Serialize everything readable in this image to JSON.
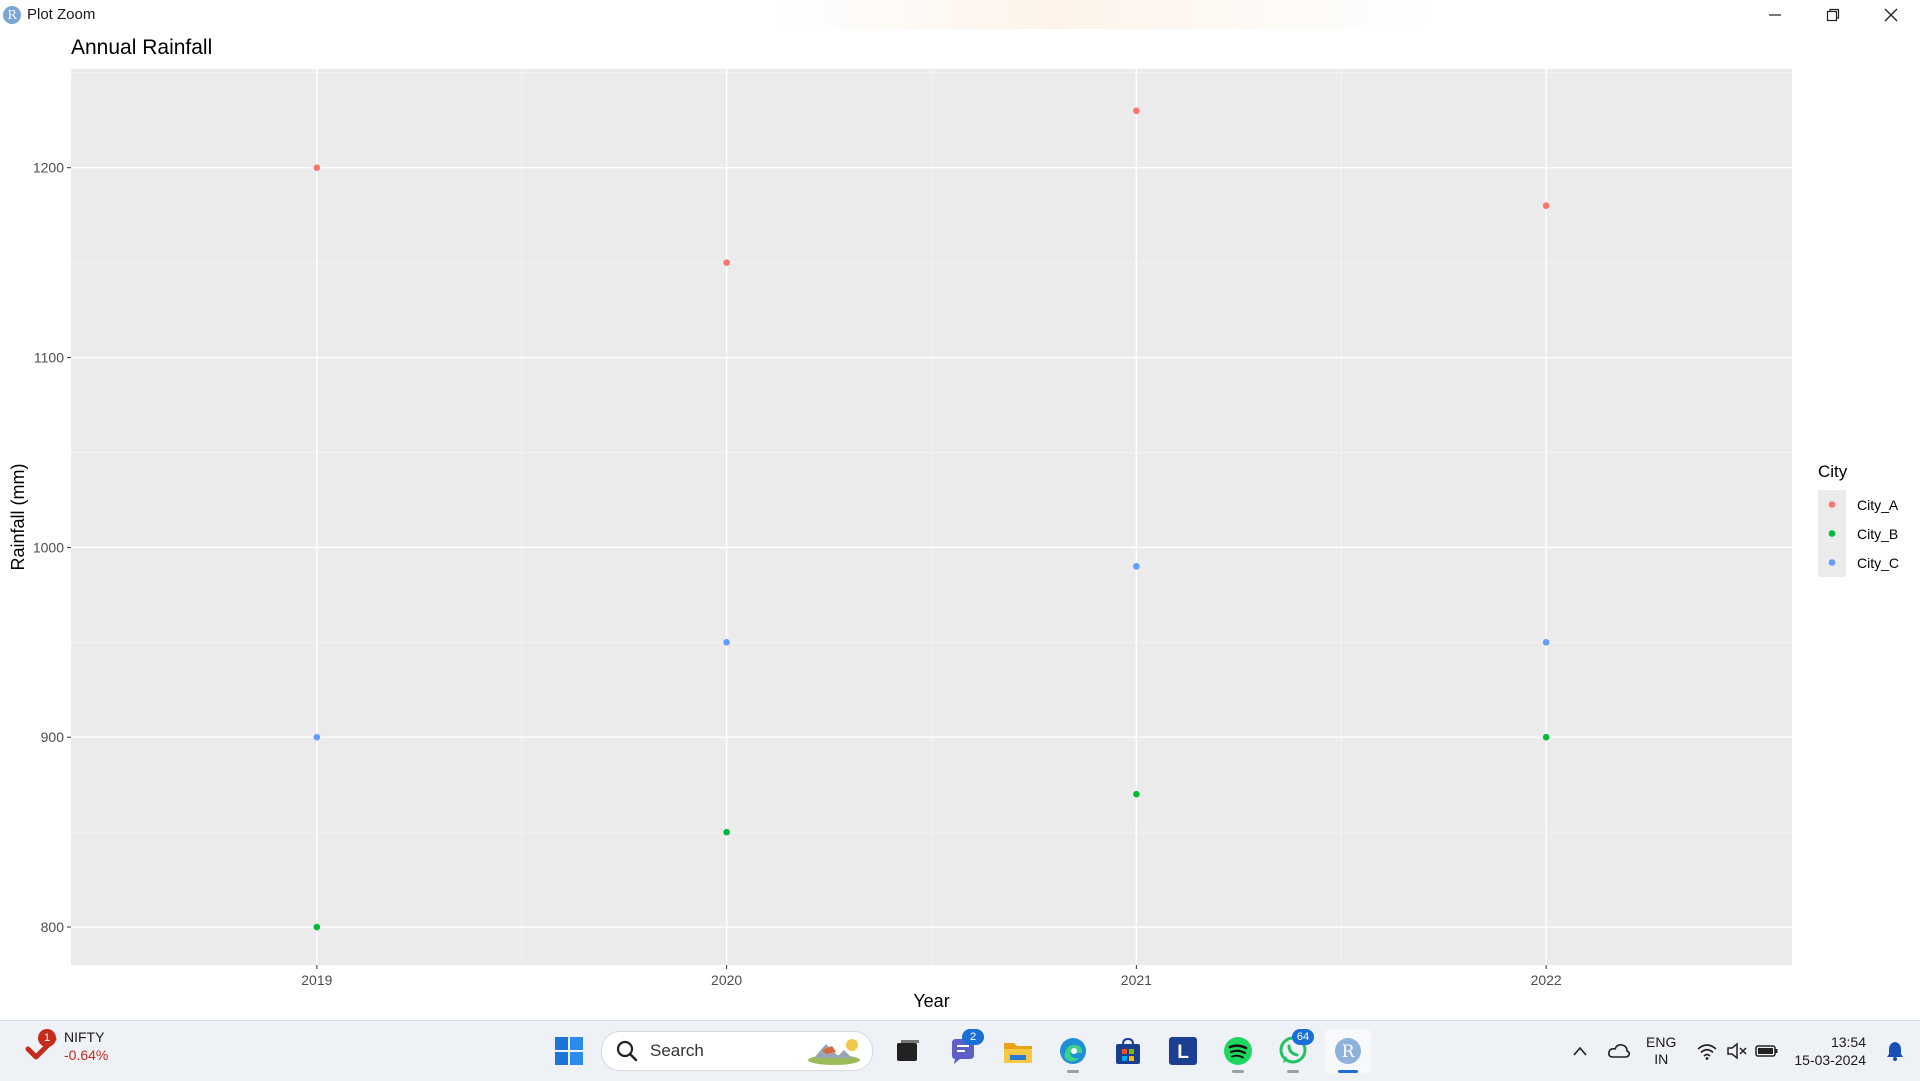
{
  "window": {
    "title": "Plot Zoom",
    "app_icon_letter": "R",
    "controls": [
      "minimize-icon",
      "restore-icon",
      "close-icon"
    ]
  },
  "chart_data": {
    "type": "scatter",
    "title": "Annual Rainfall",
    "xlabel": "Year",
    "ylabel": "Rainfall (mm)",
    "x_categories": [
      "2019",
      "2020",
      "2021",
      "2022"
    ],
    "y_ticks": [
      800,
      900,
      1000,
      1100,
      1200
    ],
    "ylim": [
      780,
      1252
    ],
    "grid": true,
    "legend": {
      "title": "City",
      "position": "right"
    },
    "series": [
      {
        "name": "City_A",
        "color": "#F8766D",
        "values": [
          1200,
          1150,
          1230,
          1180
        ]
      },
      {
        "name": "City_B",
        "color": "#00BA38",
        "values": [
          800,
          850,
          870,
          900
        ]
      },
      {
        "name": "City_C",
        "color": "#619CFF",
        "values": [
          900,
          950,
          990,
          950
        ]
      }
    ]
  },
  "taskbar": {
    "widget": {
      "name": "NIFTY",
      "change": "-0.64%",
      "badge": "1"
    },
    "search": {
      "placeholder": "Search"
    },
    "apps": [
      {
        "name": "start-button",
        "icon": "windows-logo-icon"
      },
      {
        "name": "task-view-button",
        "icon": "task-view-icon"
      },
      {
        "name": "teams-chat-button",
        "icon": "chat-icon",
        "badge": "2"
      },
      {
        "name": "file-explorer-button",
        "icon": "folder-icon"
      },
      {
        "name": "edge-button",
        "icon": "edge-icon"
      },
      {
        "name": "store-button",
        "icon": "store-icon"
      },
      {
        "name": "l-app-button",
        "icon": "l-letter-icon",
        "letter": "L"
      },
      {
        "name": "spotify-button",
        "icon": "spotify-icon"
      },
      {
        "name": "whatsapp-button",
        "icon": "whatsapp-icon",
        "badge": "64"
      },
      {
        "name": "rgui-button",
        "icon": "r-icon",
        "letter": "R"
      }
    ],
    "tray": {
      "language": "ENG",
      "region": "IN",
      "time": "13:54",
      "date": "15-03-2024"
    }
  }
}
